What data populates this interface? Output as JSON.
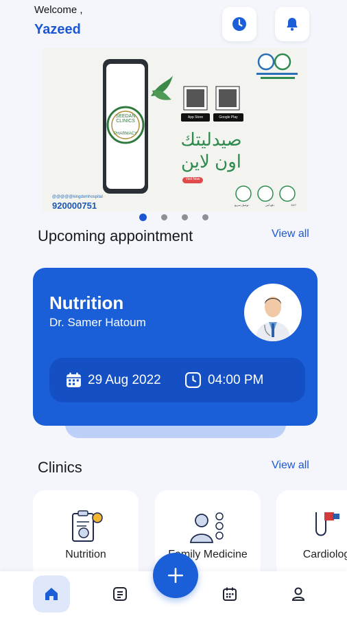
{
  "header": {
    "greeting": "Welcome ,",
    "user_name": "Yazeed"
  },
  "icons": {
    "history": "clock-icon",
    "notifications": "bell-icon"
  },
  "banner": {
    "logo_text_top": "SEEDAN CLINICS",
    "logo_text_bottom": "PHARMACY",
    "arabic_line1": "صيدليتك",
    "arabic_line2": "اون لاين",
    "phone": "920000751",
    "social": "@@@@@kingdomhospital",
    "store_app": "App Store",
    "store_play": "Google Play",
    "cta": "Visit Now",
    "features": [
      "توصيل سريع",
      "دفع آمن",
      "24/7"
    ],
    "carousel_pages": 4,
    "active_page": 1
  },
  "upcoming": {
    "title": "Upcoming appointment",
    "view_all": "View all",
    "card": {
      "specialty": "Nutrition",
      "doctor": "Dr. Samer Hatoum",
      "date": "29 Aug 2022",
      "time": "04:00 PM"
    }
  },
  "clinics": {
    "title": "Clinics",
    "view_all": "View all",
    "items": [
      {
        "label": "Nutrition",
        "icon": "nutrition-icon"
      },
      {
        "label": "Family Medicine",
        "icon": "family-medicine-icon"
      },
      {
        "label": "Cardiology",
        "icon": "cardiology-icon"
      }
    ]
  },
  "nav": {
    "items": [
      "home-icon",
      "records-icon",
      "add-icon",
      "calendar-icon",
      "profile-icon"
    ],
    "active": "home-icon"
  },
  "colors": {
    "primary": "#1a5fd7",
    "link": "#1a56d6",
    "background": "#f4f6fb",
    "card_inner": "#1450c4"
  }
}
